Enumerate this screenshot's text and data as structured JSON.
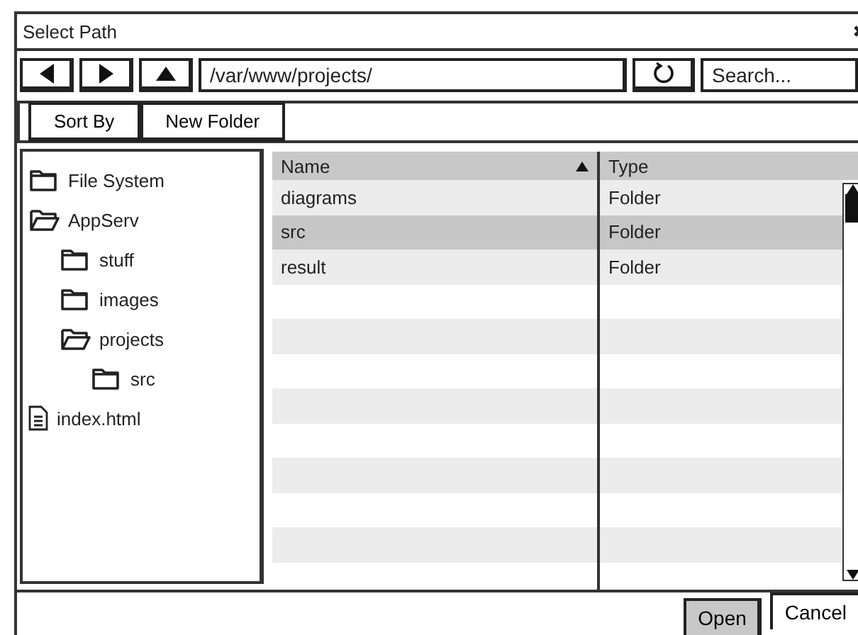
{
  "window": {
    "title": "Select Path"
  },
  "toolbar": {
    "path": "/var/www/projects/",
    "search": {
      "placeholder": "Search..."
    }
  },
  "actions": [
    "Sort By",
    "New Folder"
  ],
  "tree": [
    {
      "kind": "folder",
      "label": "File System",
      "expanded": false
    },
    {
      "kind": "folder",
      "label": "AppServ",
      "expanded": true,
      "children": [
        {
          "kind": "folder",
          "label": "stuff",
          "expanded": false
        },
        {
          "kind": "folder",
          "label": "images",
          "expanded": false
        },
        {
          "kind": "folder",
          "label": "projects",
          "expanded": true,
          "children": [
            {
              "kind": "folder",
              "label": "src",
              "expanded": false
            }
          ]
        }
      ]
    },
    {
      "kind": "file",
      "label": "index.html"
    }
  ],
  "table": {
    "columns": [
      {
        "label": "Name",
        "sorted": true
      },
      {
        "label": "Type",
        "sorted": false
      }
    ],
    "rows": [
      {
        "cells": [
          "diagrams",
          "Folder"
        ],
        "selected": false
      },
      {
        "cells": [
          "src",
          "Folder"
        ],
        "selected": true
      },
      {
        "cells": [
          "result",
          "Folder"
        ],
        "selected": false
      }
    ]
  },
  "buttons": [
    {
      "label": "Open",
      "primary": true
    },
    {
      "label": "Cancel",
      "primary": false
    }
  ]
}
